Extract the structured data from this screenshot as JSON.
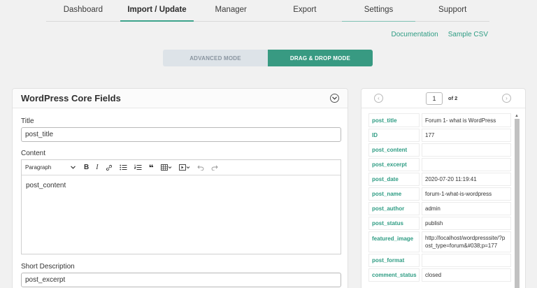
{
  "nav": {
    "tabs": [
      "Dashboard",
      "Import / Update",
      "Manager",
      "Export",
      "Settings",
      "Support"
    ]
  },
  "links": {
    "documentation": "Documentation",
    "sample_csv": "Sample CSV"
  },
  "modes": {
    "advanced": "ADVANCED MODE",
    "drag_drop": "DRAG & DROP MODE"
  },
  "core_fields": {
    "title": "WordPress Core Fields",
    "collapse_icon": "chevron-down-icon",
    "title_label": "Title",
    "title_value": "post_title",
    "content_label": "Content",
    "editor": {
      "format": "Paragraph",
      "body": "post_content"
    },
    "short_desc_label": "Short Description",
    "short_desc_value": "post_excerpt"
  },
  "preview": {
    "page": "1",
    "of": "of 2",
    "rows": [
      {
        "key": "post_title",
        "value": "Forum 1- what is WordPress"
      },
      {
        "key": "ID",
        "value": "177"
      },
      {
        "key": "post_content",
        "value": ""
      },
      {
        "key": "post_excerpt",
        "value": ""
      },
      {
        "key": "post_date",
        "value": "2020-07-20 11:19:41"
      },
      {
        "key": "post_name",
        "value": "forum-1-what-is-wordpress"
      },
      {
        "key": "post_author",
        "value": "admin"
      },
      {
        "key": "post_status",
        "value": "publish"
      },
      {
        "key": "featured_image",
        "value": "http://localhost/wordpresssite/?post_type=forum&#038;p=177"
      },
      {
        "key": "post_format",
        "value": ""
      },
      {
        "key": "comment_status",
        "value": "closed"
      }
    ]
  },
  "colors": {
    "accent": "#389a82",
    "link": "#2e9c83"
  }
}
